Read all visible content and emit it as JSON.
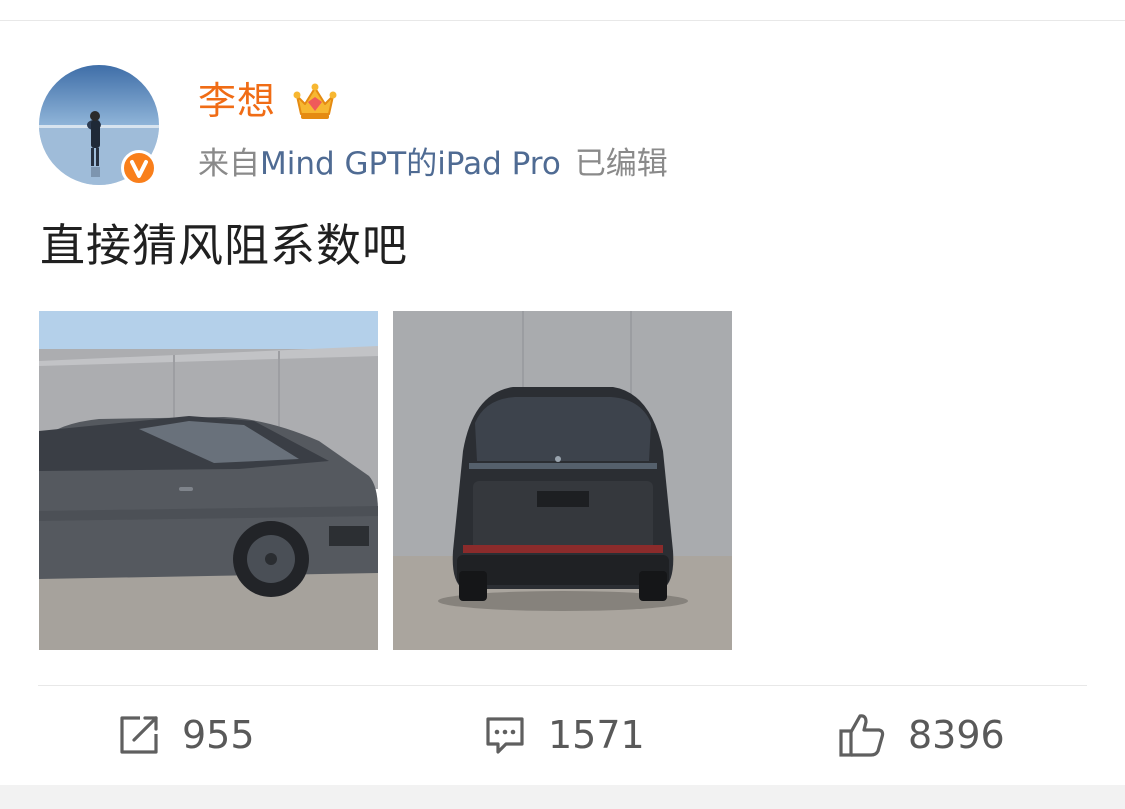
{
  "post": {
    "author": {
      "name": "李想",
      "badge_icon": "crown-icon",
      "verified_icon": "verified-v-icon",
      "accent_color": "#f06c15"
    },
    "meta": {
      "prefix": "来自",
      "source": "Mind GPT的iPad Pro",
      "edited": "已编辑"
    },
    "text": "直接猜风阻系数吧",
    "images": [
      {
        "subject": "side view of a dark grey minivan"
      },
      {
        "subject": "rear view of a dark grey minivan"
      }
    ]
  },
  "actions": {
    "repost": {
      "icon": "repost-icon",
      "count": "955"
    },
    "comment": {
      "icon": "comment-icon",
      "count": "1571"
    },
    "like": {
      "icon": "thumbs-up-icon",
      "count": "8396"
    }
  }
}
